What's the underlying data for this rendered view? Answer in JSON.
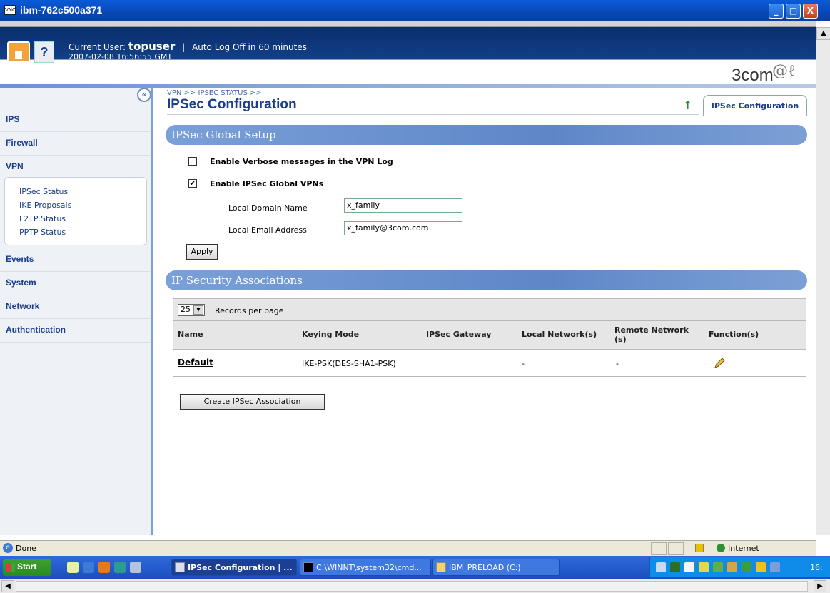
{
  "window": {
    "title": "ibm-762c500a371",
    "icon": "vnc-icon",
    "minimize": "_",
    "maximize": "□",
    "close": "X"
  },
  "header": {
    "current_user_label": "Current User:",
    "current_user": "topuser",
    "separator": "|",
    "auto_label": "Auto",
    "logoff_link": "Log Off",
    "logoff_suffix": "in 60 minutes",
    "datetime": "2007-02-08 16:56:55 GMT",
    "help_label": "?",
    "logo_text": "3com",
    "logo_swirl": "@ℓ"
  },
  "sidebar": {
    "collapse_label": "«",
    "items": [
      {
        "label": "IPS"
      },
      {
        "label": "Firewall"
      },
      {
        "label": "VPN"
      },
      {
        "label": "Events"
      },
      {
        "label": "System"
      },
      {
        "label": "Network"
      },
      {
        "label": "Authentication"
      }
    ],
    "vpn_submenu": [
      {
        "label": "IPSec Status"
      },
      {
        "label": "IKE Proposals"
      },
      {
        "label": "L2TP Status"
      },
      {
        "label": "PPTP Status"
      }
    ]
  },
  "breadcrumb": {
    "root": "VPN >>",
    "link": "IPSEC STATUS",
    "suffix": ">>"
  },
  "page": {
    "title": "IPSec Configuration",
    "tab_label": "IPSec Configuration",
    "up_icon": "up-arrow-icon"
  },
  "global_setup": {
    "heading": "IPSec Global Setup",
    "verbose_label": "Enable Verbose messages in the VPN Log",
    "verbose_checked": false,
    "global_vpn_label": "Enable IPSec Global VPNs",
    "global_vpn_checked": true,
    "domain_label": "Local Domain Name",
    "domain_value": "x_family",
    "email_label": "Local Email Address",
    "email_value": "x_family@3com.com",
    "apply_label": "Apply",
    "check_mark": "✔"
  },
  "associations": {
    "heading": "IP Security Associations",
    "records_value": "25",
    "records_label": "Records per page",
    "columns": [
      "Name",
      "Keying Mode",
      "IPSec Gateway",
      "Local Network(s)",
      "Remote Network (s)",
      "Function(s)"
    ],
    "rows": [
      {
        "name": "Default",
        "keying_mode": "IKE-PSK(DES-SHA1-PSK)",
        "gateway": "",
        "local": "-",
        "remote": "-",
        "function_icon": "edit-pencil-icon"
      }
    ],
    "create_label": "Create IPSec Association"
  },
  "statusbar": {
    "status": "Done",
    "zone": "Internet"
  },
  "taskbar": {
    "start_label": "Start",
    "tasks": [
      {
        "label": "IPSec Configuration | ..."
      },
      {
        "label": "C:\\WINNT\\system32\\cmd..."
      },
      {
        "label": "IBM_PRELOAD (C:)"
      }
    ],
    "clock": "16:"
  },
  "colors": {
    "accent": "#1a3d8a",
    "section_bar": "#5f86c8",
    "header_bg": "#0a2f6d"
  }
}
